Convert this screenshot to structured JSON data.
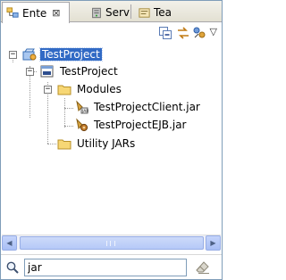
{
  "tabs": [
    {
      "label": "Ente",
      "icon": "enterprise-explorer-icon",
      "active": true,
      "close": "⊠"
    },
    {
      "label": "Serv",
      "icon": "servers-icon",
      "active": false
    },
    {
      "label": "Tea",
      "icon": "team-icon",
      "active": false
    }
  ],
  "toolbar": {
    "buttons": [
      "collapse-all-icon",
      "link-with-editor-icon",
      "filter-icon"
    ],
    "menu": "▽"
  },
  "tree": {
    "items": [
      {
        "label": "TestProject",
        "icon": "ear-project-icon",
        "toggle": "−",
        "selected": true
      },
      {
        "label": "TestProject",
        "icon": "deployment-descriptor-icon",
        "toggle": "−"
      },
      {
        "label": "Modules",
        "icon": "folder-icon",
        "toggle": "−"
      },
      {
        "label": "TestProjectClient.jar",
        "icon": "client-jar-icon"
      },
      {
        "label": "TestProjectEJB.jar",
        "icon": "ejb-jar-icon"
      },
      {
        "label": "Utility JARs",
        "icon": "folder-icon"
      }
    ]
  },
  "search": {
    "value": "jar",
    "icon": "search-icon",
    "clear_icon": "eraser-icon"
  },
  "scrollbar": {
    "left": "◀",
    "right": "▶"
  }
}
